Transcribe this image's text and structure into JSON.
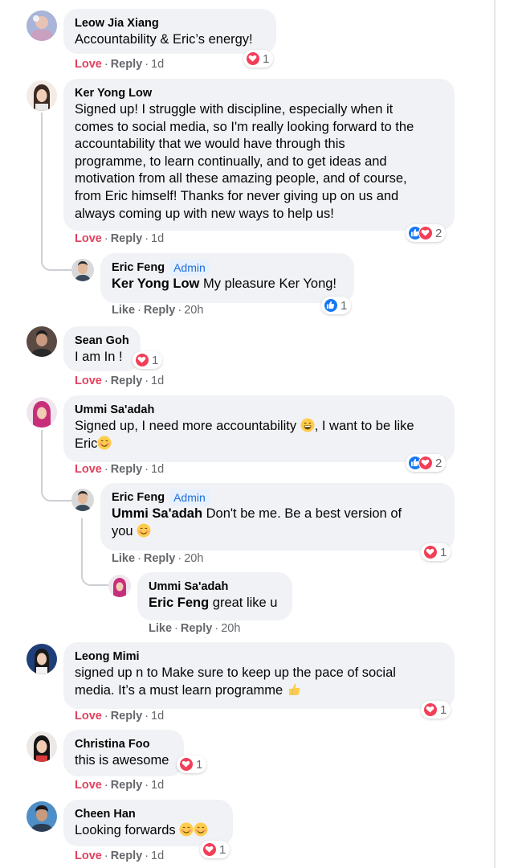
{
  "comments": [
    {
      "name": "Leow Jia Xiang",
      "text": "Accountability & Eric’s energy!",
      "love": "Love",
      "reply": "Reply",
      "time": "1d",
      "reactions": "1"
    },
    {
      "name": "Ker Yong Low",
      "lines": [
        "Signed up! I struggle with discipline, especially when it",
        "comes to social media, so I'm really looking forward to the",
        "accountability that we would have through this",
        "programme, to learn continually, and to get ideas and",
        "motivation from all these amazing people, and of course,",
        "from Eric himself! Thanks for never giving up on us and",
        "always coming up with new ways to help us!"
      ],
      "love": "Love",
      "reply": "Reply",
      "time": "1d",
      "reactions": "2"
    },
    {
      "name": "Eric Feng",
      "badge": "Admin",
      "mention": "Ker Yong Low",
      "text": " My pleasure Ker Yong!",
      "like": "Like",
      "reply": "Reply",
      "time": "20h",
      "reactions": "1"
    },
    {
      "name": "Sean Goh",
      "text": "I am In !",
      "love": "Love",
      "reply": "Reply",
      "time": "1d",
      "reactions": "1"
    },
    {
      "name": "Ummi Sa'adah",
      "line1a": "Signed up, I need more accountability ",
      "line1b": ", I want to be like",
      "line2": "Eric",
      "love": "Love",
      "reply": "Reply",
      "time": "1d",
      "reactions": "2"
    },
    {
      "name": "Eric Feng",
      "badge": "Admin",
      "mention": "Ummi Sa'adah",
      "text": " Don't be me. Be a best version of",
      "line2": "you ",
      "like": "Like",
      "reply": "Reply",
      "time": "20h",
      "reactions": "1"
    },
    {
      "name": "Ummi Sa'adah",
      "mention": "Eric Feng",
      "text": " great like u",
      "like": "Like",
      "reply": "Reply",
      "time": "20h"
    },
    {
      "name": "Leong Mimi",
      "line1": "signed up n to Make sure to keep up the pace of social",
      "line2": "media. It’s a must learn programme ",
      "love": "Love",
      "reply": "Reply",
      "time": "1d",
      "reactions": "1"
    },
    {
      "name": "Christina Foo",
      "text": "this is awesome",
      "love": "Love",
      "reply": "Reply",
      "time": "1d",
      "reactions": "1"
    },
    {
      "name": "Cheen Han",
      "text": "Looking forwards ",
      "love": "Love",
      "reply": "Reply",
      "time": "1d",
      "reactions": "1"
    }
  ],
  "colors": {
    "love": "#e4405f",
    "like": "#1877f2",
    "bubble": "#f0f2f5",
    "admin": "#216fdb"
  }
}
